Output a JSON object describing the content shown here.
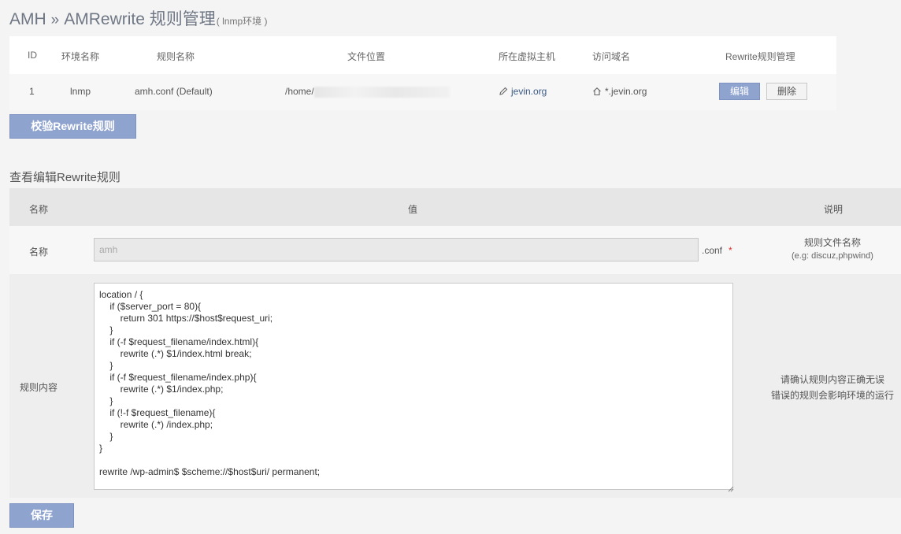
{
  "header": {
    "brand": "AMH",
    "separator": "»",
    "title": "AMRewrite 规则管理",
    "subtitle": "( lnmp环境 )"
  },
  "rules_table": {
    "columns": [
      "ID",
      "环境名称",
      "规则名称",
      "文件位置",
      "所在虚拟主机",
      "访问域名",
      "Rewrite规则管理"
    ],
    "rows": [
      {
        "id": "1",
        "env": "lnmp",
        "rule_name": "amh.conf  (Default)",
        "file_path": "/home/",
        "vhost": "jevin.org",
        "domain": "*.jevin.org",
        "edit_label": "编辑",
        "delete_label": "删除"
      }
    ]
  },
  "verify_button": "校验Rewrite规则",
  "editor": {
    "section_title": "查看编辑Rewrite规则",
    "columns": [
      "名称",
      "值",
      "说明"
    ],
    "name_row": {
      "label": "名称",
      "value": "amh",
      "suffix": ".conf",
      "required": "*",
      "desc": "规则文件名称",
      "hint": "(e.g: discuz,phpwind)"
    },
    "content_row": {
      "label": "规则内容",
      "value": "location / {\n\tif ($server_port = 80){\n\t\treturn 301 https://$host$request_uri;\n\t}\n\tif (-f $request_filename/index.html){\n\t\trewrite (.*) $1/index.html break;\n\t}\n\tif (-f $request_filename/index.php){\n\t\trewrite (.*) $1/index.php;\n\t}\n\tif (!-f $request_filename){\n\t\trewrite (.*) /index.php;\n\t}\n}\n\nrewrite /wp-admin$ $scheme://$host$uri/ permanent;",
      "note_line1": "请确认规则内容正确无误",
      "note_line2": "错误的规则会影响环境的运行"
    },
    "save_button": "保存"
  }
}
